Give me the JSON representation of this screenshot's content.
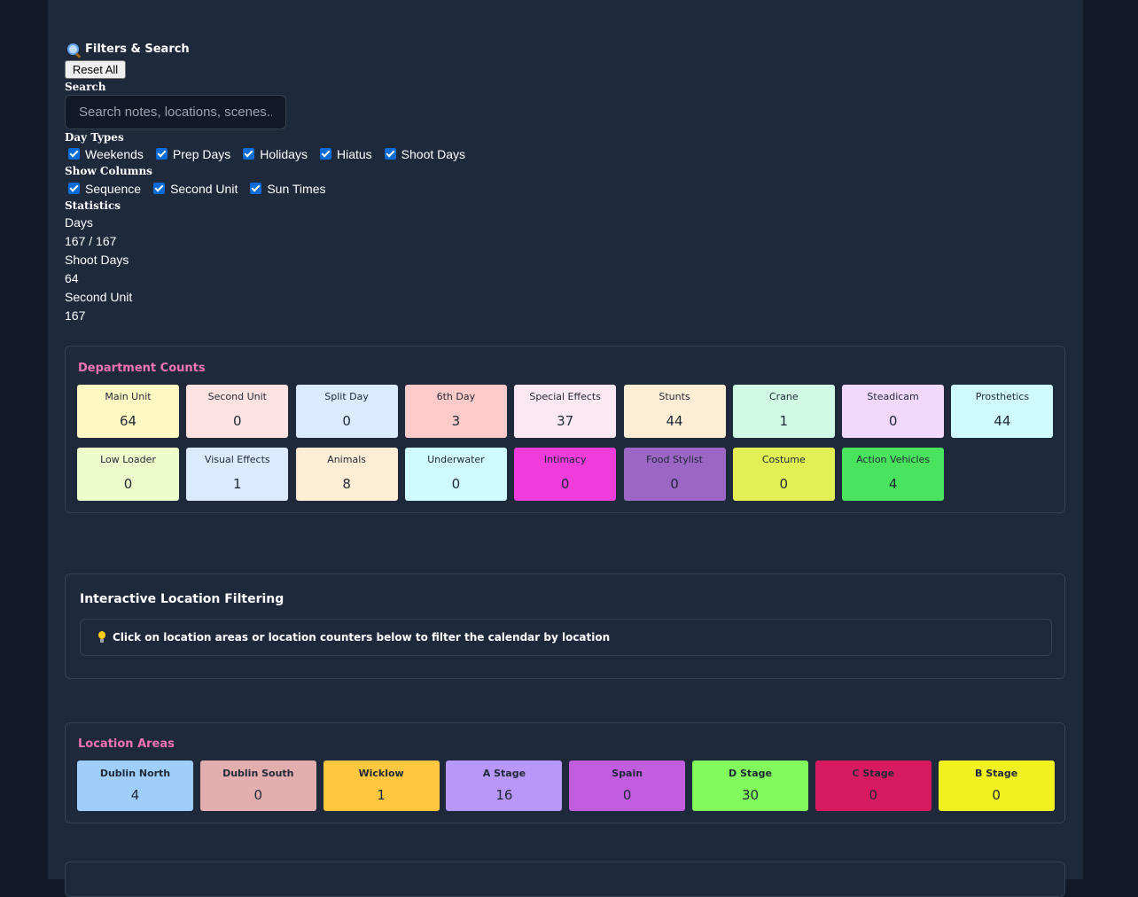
{
  "filters": {
    "title": "Filters & Search",
    "reset_label": "Reset All",
    "search_label": "Search",
    "search_placeholder": "Search notes, locations, scenes...",
    "day_types_label": "Day Types",
    "day_types": [
      {
        "label": "Weekends",
        "checked": true
      },
      {
        "label": "Prep Days",
        "checked": true
      },
      {
        "label": "Holidays",
        "checked": true
      },
      {
        "label": "Hiatus",
        "checked": true
      },
      {
        "label": "Shoot Days",
        "checked": true
      }
    ],
    "columns_label": "Show Columns",
    "columns": [
      {
        "label": "Sequence",
        "checked": true
      },
      {
        "label": "Second Unit",
        "checked": true
      },
      {
        "label": "Sun Times",
        "checked": true
      }
    ]
  },
  "statistics": {
    "label": "Statistics",
    "items": [
      {
        "label": "Days",
        "value": "167 / 167"
      },
      {
        "label": "Shoot Days",
        "value": "64"
      },
      {
        "label": "Second Unit",
        "value": "167"
      }
    ]
  },
  "departments": {
    "title": "Department Counts",
    "items": [
      {
        "label": "Main Unit",
        "value": "64",
        "color": "#fef9c3"
      },
      {
        "label": "Second Unit",
        "value": "0",
        "color": "#fee2e2"
      },
      {
        "label": "Split Day",
        "value": "0",
        "color": "#dbeafe"
      },
      {
        "label": "6th Day",
        "value": "3",
        "color": "#fecaca"
      },
      {
        "label": "Special Effects",
        "value": "37",
        "color": "#fce7f3"
      },
      {
        "label": "Stunts",
        "value": "44",
        "color": "#ffedd5"
      },
      {
        "label": "Crane",
        "value": "1",
        "color": "#d1fae5"
      },
      {
        "label": "Steadicam",
        "value": "0",
        "color": "#f3d8fe"
      },
      {
        "label": "Prosthetics",
        "value": "44",
        "color": "#cffafe"
      },
      {
        "label": "Low Loader",
        "value": "0",
        "color": "#ecfccb"
      },
      {
        "label": "Visual Effects",
        "value": "1",
        "color": "#dbeafe"
      },
      {
        "label": "Animals",
        "value": "8",
        "color": "#ffedd5"
      },
      {
        "label": "Underwater",
        "value": "0",
        "color": "#cffafe"
      },
      {
        "label": "Intimacy",
        "value": "0",
        "color": "#f03cdb"
      },
      {
        "label": "Food Stylist",
        "value": "0",
        "color": "#9b66c4"
      },
      {
        "label": "Costume",
        "value": "0",
        "color": "#e2f055"
      },
      {
        "label": "Action Vehicles",
        "value": "4",
        "color": "#4ae35e"
      }
    ]
  },
  "interactive": {
    "title": "Interactive Location Filtering",
    "hint": "Click on location areas or location counters below to filter the calendar by location"
  },
  "locations": {
    "title": "Location Areas",
    "items": [
      {
        "label": "Dublin North",
        "value": "4",
        "color": "#a0cefa"
      },
      {
        "label": "Dublin South",
        "value": "0",
        "color": "#e2aeae"
      },
      {
        "label": "Wicklow",
        "value": "1",
        "color": "#fec73f"
      },
      {
        "label": "A Stage",
        "value": "16",
        "color": "#b997f8"
      },
      {
        "label": "Spain",
        "value": "0",
        "color": "#c25de0"
      },
      {
        "label": "D Stage",
        "value": "30",
        "color": "#82fa5d"
      },
      {
        "label": "C Stage",
        "value": "0",
        "color": "#d81b60"
      },
      {
        "label": "B Stage",
        "value": "0",
        "color": "#f0f11e"
      }
    ]
  }
}
